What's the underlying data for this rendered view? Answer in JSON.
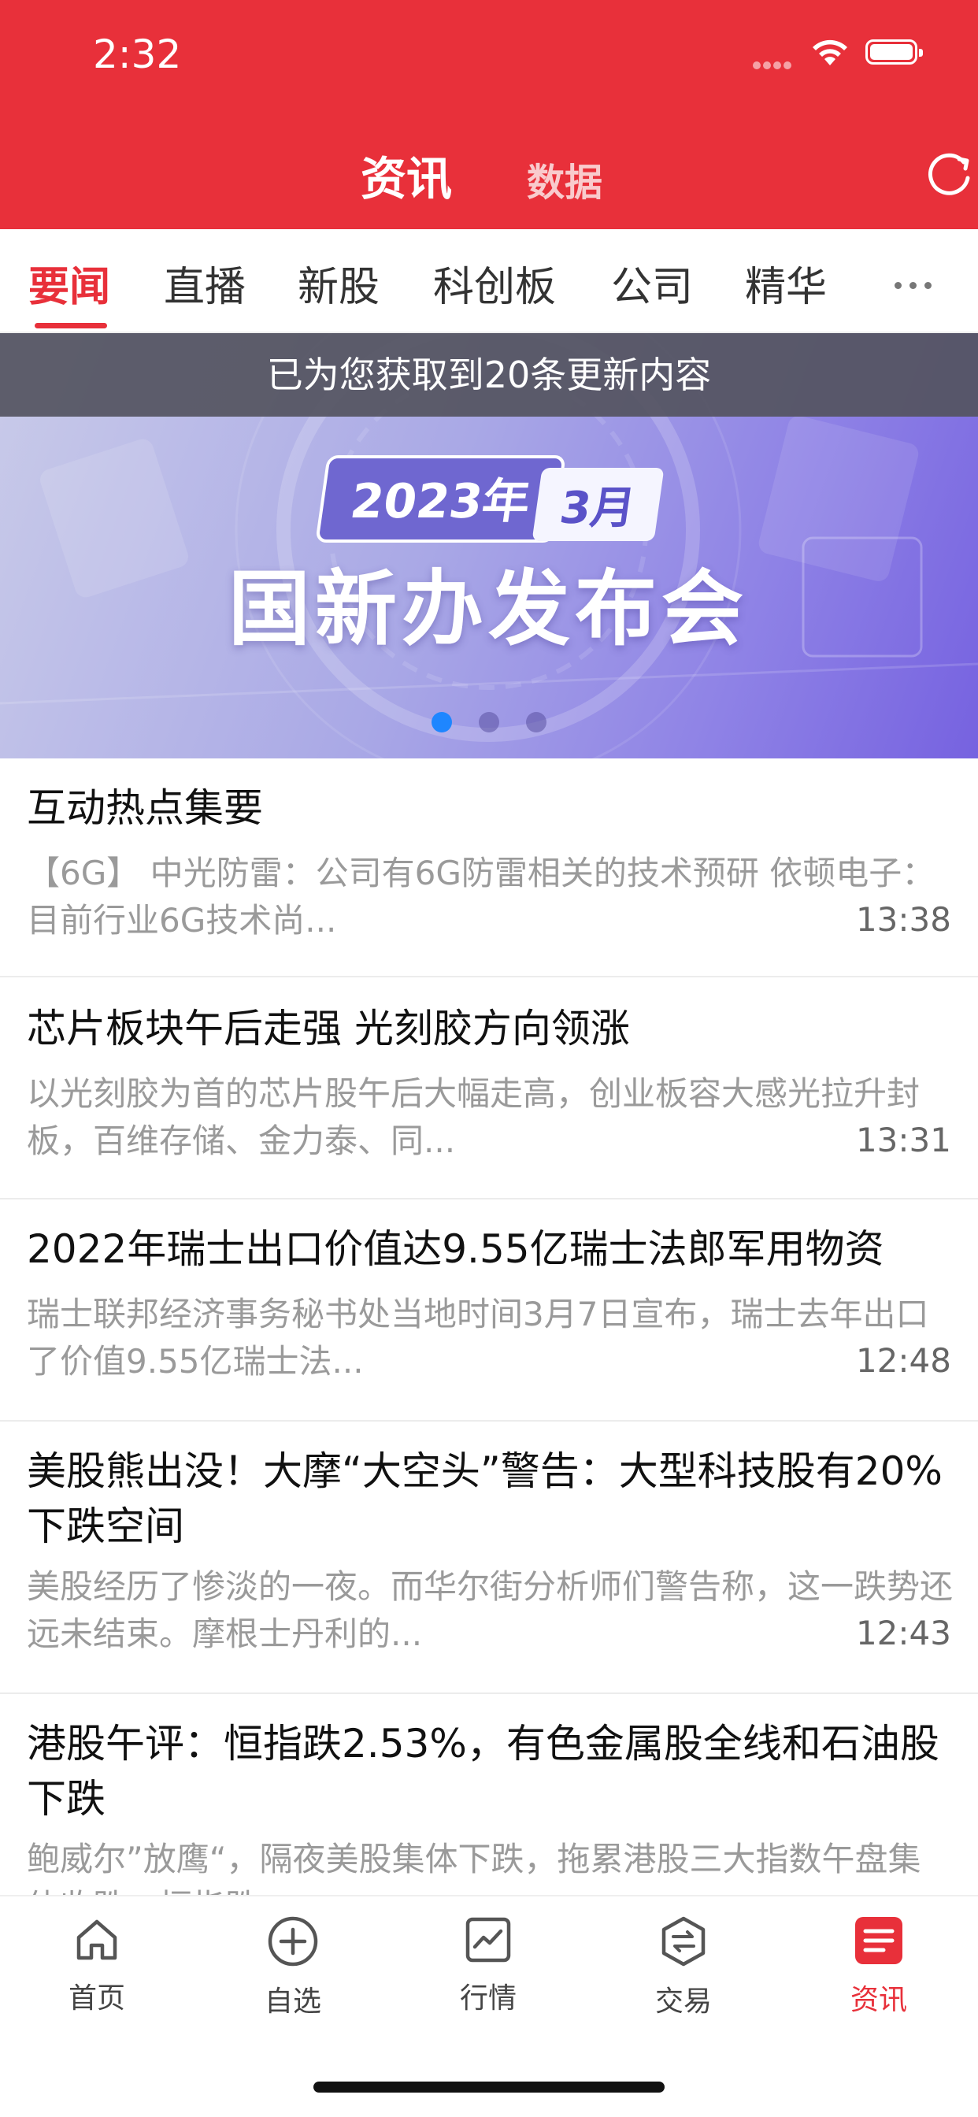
{
  "status_bar": {
    "time": "2:32"
  },
  "header": {
    "tabs": [
      {
        "label": "资讯",
        "active": true
      },
      {
        "label": "数据",
        "active": false
      }
    ],
    "refresh_icon": "refresh-icon",
    "background_color": "#e8303a"
  },
  "category_tabs": {
    "items": [
      {
        "label": "要闻",
        "active": true
      },
      {
        "label": "直播",
        "active": false
      },
      {
        "label": "新股",
        "active": false
      },
      {
        "label": "科创板",
        "active": false
      },
      {
        "label": "公司",
        "active": false
      },
      {
        "label": "精华",
        "active": false
      }
    ],
    "more_icon": "more-dots-icon"
  },
  "update_notice": "已为您获取到20条更新内容",
  "banner": {
    "year": "2023年",
    "month": "3月",
    "title": "国新办发布会",
    "dots_count": 3,
    "active_dot": 0
  },
  "news": [
    {
      "title": "互动热点集要",
      "summary": "【6G】 中光防雷：公司有6G防雷相关的技术预研 依顿电子：目前行业6G技术尚...",
      "time": "13:38"
    },
    {
      "title": "芯片板块午后走强 光刻胶方向领涨",
      "summary": "以光刻胶为首的芯片股午后大幅走高，创业板容大感光拉升封板，百维存储、金力泰、同...",
      "time": "13:31"
    },
    {
      "title": "2022年瑞士出口价值达9.55亿瑞士法郎军用物资",
      "summary": "瑞士联邦经济事务秘书处当地时间3月7日宣布，瑞士去年出口了价值9.55亿瑞士法...",
      "time": "12:48"
    },
    {
      "title": "美股熊出没！大摩“大空头”警告：大型科技股有20%下跌空间",
      "summary": "美股经历了惨淡的一夜。而华尔街分析师们警告称，这一跌势还远未结束。摩根士丹利的...",
      "time": "12:43"
    },
    {
      "title": "港股午评：恒指跌2.53%，有色金属股全线和石油股下跌",
      "summary": "鲍威尔”放鹰“，隔夜美股集体下跌，拖累港股三大指数午盘集体收跌，恒指跌...",
      "time": ""
    }
  ],
  "bottom_tabs": [
    {
      "label": "首页",
      "icon": "home-icon",
      "active": false
    },
    {
      "label": "自选",
      "icon": "plus-circle-icon",
      "active": false
    },
    {
      "label": "行情",
      "icon": "chart-icon",
      "active": false
    },
    {
      "label": "交易",
      "icon": "exchange-icon",
      "active": false
    },
    {
      "label": "资讯",
      "icon": "news-icon",
      "active": true
    }
  ]
}
